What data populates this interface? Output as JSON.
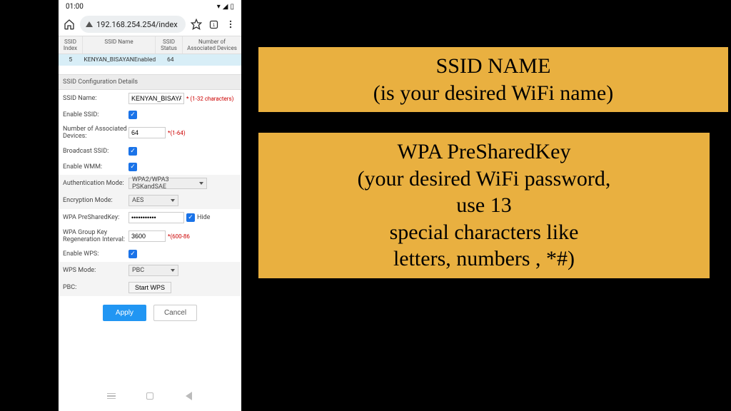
{
  "statusbar": {
    "time": "01:00"
  },
  "browser": {
    "url": "192.168.254.254/index"
  },
  "table": {
    "headers": {
      "ssid_index": "SSID Index",
      "ssid_name": "SSID Name",
      "ssid_status": "SSID Status",
      "num_assoc": "Number of Associated Devices"
    },
    "row": {
      "index": "5",
      "name": "KENYAN_BISAYAN",
      "status": "Enabled",
      "devices": "64"
    }
  },
  "section_title": "SSID Configuration Details",
  "form": {
    "ssid_name_label": "SSID Name:",
    "ssid_name_value": "KENYAN_BISAYAN",
    "ssid_name_hint": "* (1-32 characters)",
    "enable_ssid_label": "Enable SSID:",
    "num_assoc_label": "Number of Associated Devices:",
    "num_assoc_value": "64",
    "num_assoc_hint": "*(1-64)",
    "broadcast_label": "Broadcast SSID:",
    "wmm_label": "Enable WMM:",
    "auth_label": "Authentication Mode:",
    "auth_value": "WPA2/WPA3 PSKandSAE",
    "enc_label": "Encryption Mode:",
    "enc_value": "AES",
    "psk_label": "WPA PreSharedKey:",
    "psk_value": "•••••••••••",
    "psk_hide": "Hide",
    "groupkey_label": "WPA Group Key Regeneration Interval:",
    "groupkey_value": "3600",
    "groupkey_hint": "*(600-86",
    "wps_label": "Enable WPS:",
    "wpsmode_label": "WPS Mode:",
    "wpsmode_value": "PBC",
    "pbc_label": "PBC:",
    "pbc_btn": "Start WPS"
  },
  "buttons": {
    "apply": "Apply",
    "cancel": "Cancel"
  },
  "callout1": {
    "line1": "SSID NAME",
    "line2": "(is your desired WiFi name)"
  },
  "callout2": {
    "line1": "WPA PreSharedKey",
    "line2": "(your desired WiFi password,",
    "line3": "use 13",
    "line4": "special characters like",
    "line5": "letters, numbers , *#)"
  }
}
